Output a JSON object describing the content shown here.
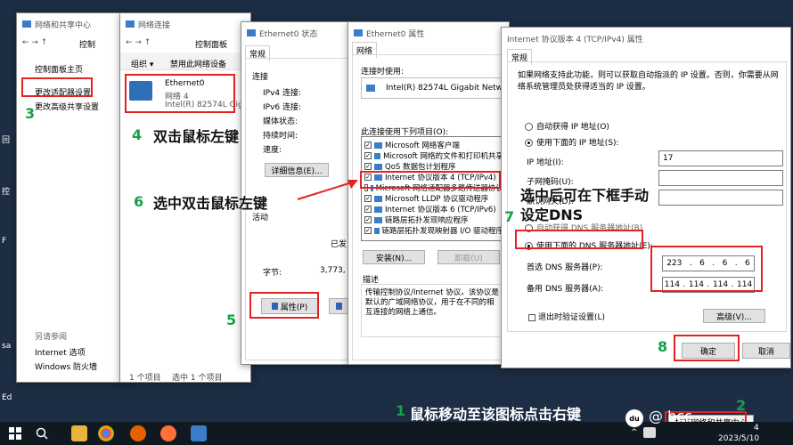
{
  "desktop": {
    "left_labels": [
      "回",
      "控",
      "F",
      "sa",
      "Ed"
    ]
  },
  "net_center": {
    "title": "网络和共享中心",
    "addr": "控制",
    "home": "控制面板主页",
    "change_adapter": "更改适配器设置",
    "change_sharing": "更改高级共享设置",
    "see_also": "另请参阅",
    "internet_options": "Internet 选项",
    "firewall": "Windows 防火墙"
  },
  "net_conn": {
    "title": "网络连接",
    "addr": "控制面板",
    "organize": "组织 ▾",
    "disable": "禁用此网络设备",
    "adapter_name": "Ethernet0",
    "adapter_net": "网络 4",
    "adapter_dev": "Intel(R) 82574L Gigab",
    "status": "1 个项目",
    "selected": "选中 1 个项目"
  },
  "status_win": {
    "title": "Ethernet0 状态",
    "tab": "常规",
    "connection": "连接",
    "ipv4": "IPv4 连接:",
    "ipv6": "IPv6 连接:",
    "media": "媒体状态:",
    "duration": "持续时间:",
    "speed": "速度:",
    "details": "详细信息(E)...",
    "activity": "活动",
    "sent": "已发",
    "bytes": "字节:",
    "bytes_val": "3,773,",
    "props": "属性(P)"
  },
  "props_win": {
    "title": "Ethernet0 属性",
    "tab": "网络",
    "connect_using": "连接时使用:",
    "adapter": "Intel(R) 82574L Gigabit Network",
    "items_label": "此连接使用下列项目(O):",
    "items": [
      {
        "label": "Microsoft 网络客户端",
        "checked": true
      },
      {
        "label": "Microsoft 网络的文件和打印机共享",
        "checked": true
      },
      {
        "label": "QoS 数据包计划程序",
        "checked": true
      },
      {
        "label": "Internet 协议版本 4 (TCP/IPv4)",
        "checked": true
      },
      {
        "label": "Microsoft 网络适配器多路传送器协议",
        "checked": false
      },
      {
        "label": "Microsoft LLDP 协议驱动程序",
        "checked": true
      },
      {
        "label": "Internet 协议版本 6 (TCP/IPv6)",
        "checked": true
      },
      {
        "label": "链路层拓扑发现响应程序",
        "checked": true
      },
      {
        "label": "链路层拓扑发现映射器 I/O 驱动程序",
        "checked": true
      }
    ],
    "install": "安装(N)...",
    "uninstall": "卸载(U)",
    "desc_label": "描述",
    "desc_text": "传输控制协议/Internet 协议。该协议是默认的广域网络协议，用于在不同的相互连接的网络上通信。"
  },
  "ipv4_win": {
    "title": "Internet 协议版本 4 (TCP/IPv4) 属性",
    "tab": "常规",
    "intro": "如果网络支持此功能，则可以获取自动指派的 IP 设置。否则，你需要从网络系统管理员处获得适当的 IP 设置。",
    "auto_ip": "自动获得 IP 地址(O)",
    "manual_ip": "使用下面的 IP 地址(S):",
    "ip_addr": "IP 地址(I):",
    "ip_val": "17",
    "subnet": "子网掩码(U):",
    "gateway": "默认网关(D):",
    "auto_dns": "自动获得 DNS 服务器地址(B)",
    "manual_dns": "使用下面的 DNS 服务器地址(E):",
    "pref_dns": "首选 DNS 服务器(P):",
    "pref_dns_val": [
      "223",
      "6",
      "6",
      "6"
    ],
    "alt_dns": "备用 DNS 服务器(A):",
    "alt_dns_val": [
      "114",
      "114",
      "114",
      "114"
    ],
    "validate": "退出时验证设置(L)",
    "advanced": "高级(V)...",
    "ok": "确定",
    "cancel": "取消"
  },
  "annotations": {
    "n1": "1",
    "t1": "鼠标移动至该图标点击右键",
    "n2": "2",
    "n3": "3",
    "n4": "4",
    "t4": "双击鼠标左键",
    "n5": "5",
    "n6": "6",
    "t6": "选中双击鼠标左键",
    "n7": "7",
    "t7a": "选中后可在下框手动",
    "t7b": "设定DNS",
    "n8": "8"
  },
  "taskbar": {
    "tray_popup": "打开网络和共享中心",
    "watermark": "@ bcc",
    "clock_time": "4",
    "clock_date": "2023/5/10"
  }
}
